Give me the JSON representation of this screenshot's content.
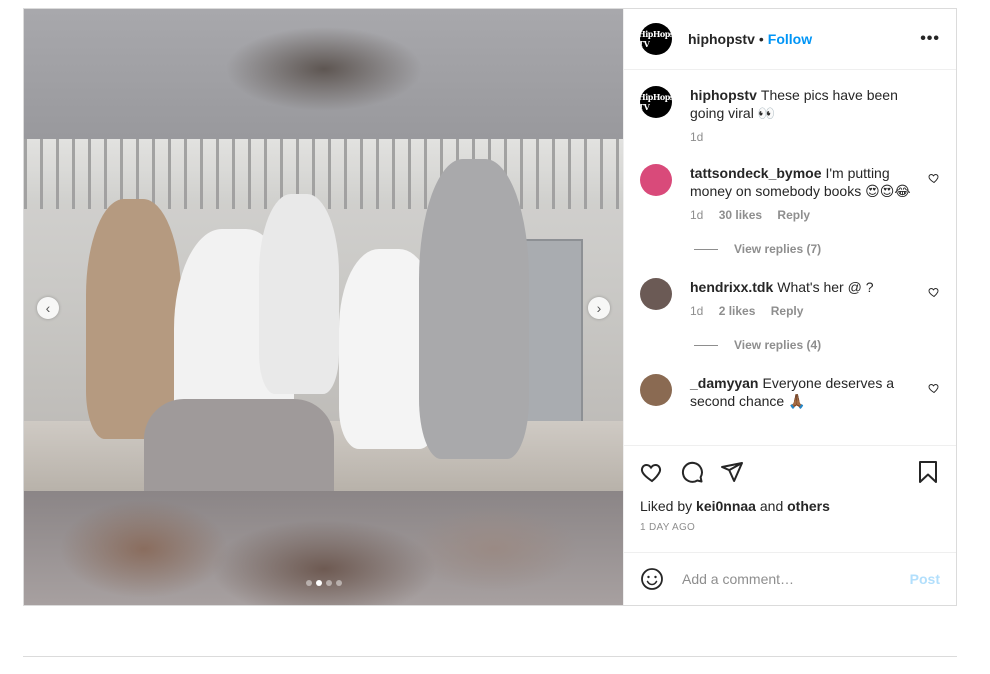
{
  "post": {
    "author": "hiphopstv",
    "avatar_text": "HipHops TV",
    "separator": "•",
    "follow_label": "Follow",
    "more_label": "•••",
    "caption": {
      "username": "hiphopstv",
      "text": "These pics have been going viral 👀",
      "time": "1d"
    },
    "carousel": {
      "total": 4,
      "active_index": 1
    },
    "comments": [
      {
        "username": "tattsondeck_bymoe",
        "text": "I'm putting money on somebody books 😍😍😂",
        "time": "1d",
        "likes": "30 likes",
        "reply": "Reply",
        "view_replies": "View replies (7)",
        "avatar_color": "#d94a7a"
      },
      {
        "username": "hendrixx.tdk",
        "text": "What's her @ ?",
        "time": "1d",
        "likes": "2 likes",
        "reply": "Reply",
        "view_replies": "View replies (4)",
        "avatar_color": "#6b5a55"
      },
      {
        "username": "_damyyan",
        "text": "Everyone deserves a second chance 🙏🏾",
        "avatar_color": "#8a6a52"
      }
    ],
    "liked_by": {
      "prefix": "Liked by",
      "user": "kei0nnaa",
      "and": "and",
      "others": "others"
    },
    "date": "1 DAY AGO",
    "add_comment": {
      "placeholder": "Add a comment…",
      "post_label": "Post"
    },
    "icons": [
      "heart-icon",
      "comment-icon",
      "share-icon",
      "bookmark-icon",
      "emoji-icon",
      "more-icon",
      "chevron-left-icon",
      "chevron-right-icon"
    ],
    "colors": {
      "link": "#0095f6",
      "post_disabled": "#b2dffc",
      "muted": "#8e8e8e"
    }
  }
}
